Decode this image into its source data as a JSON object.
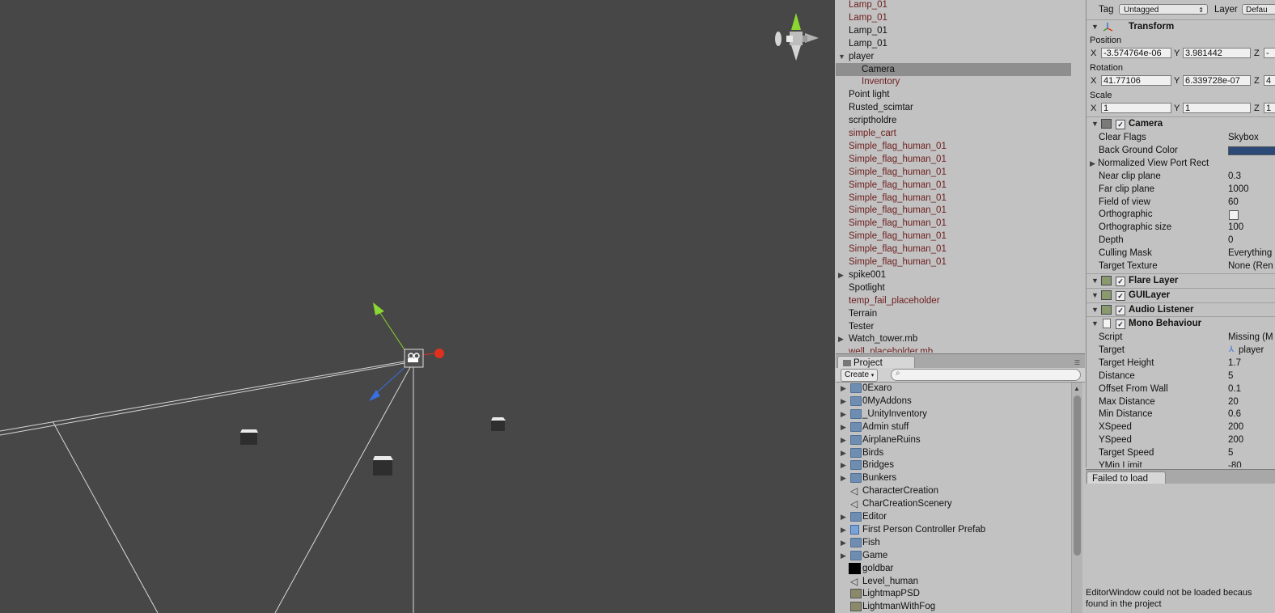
{
  "hierarchy": {
    "items": [
      {
        "label": "Lamp_01",
        "prefab": true
      },
      {
        "label": "Lamp_01",
        "prefab": true
      },
      {
        "label": "Lamp_01",
        "prefab": false
      },
      {
        "label": "Lamp_01",
        "prefab": false
      },
      {
        "label": "player",
        "prefab": false,
        "expanded": true
      },
      {
        "label": "Camera",
        "prefab": false,
        "selected": true,
        "child": true
      },
      {
        "label": "Inventory",
        "prefab": true,
        "child": true
      },
      {
        "label": "Point light",
        "prefab": false
      },
      {
        "label": "Rusted_scimtar",
        "prefab": false
      },
      {
        "label": "scriptholdre",
        "prefab": false
      },
      {
        "label": "simple_cart",
        "prefab": true
      },
      {
        "label": "Simple_flag_human_01",
        "prefab": true
      },
      {
        "label": "Simple_flag_human_01",
        "prefab": true
      },
      {
        "label": "Simple_flag_human_01",
        "prefab": true
      },
      {
        "label": "Simple_flag_human_01",
        "prefab": true
      },
      {
        "label": "Simple_flag_human_01",
        "prefab": true
      },
      {
        "label": "Simple_flag_human_01",
        "prefab": true
      },
      {
        "label": "Simple_flag_human_01",
        "prefab": true
      },
      {
        "label": "Simple_flag_human_01",
        "prefab": true
      },
      {
        "label": "Simple_flag_human_01",
        "prefab": true
      },
      {
        "label": "Simple_flag_human_01",
        "prefab": true
      },
      {
        "label": "spike001",
        "prefab": false,
        "collapsed": true
      },
      {
        "label": "Spotlight",
        "prefab": false
      },
      {
        "label": "temp_fail_placeholder",
        "prefab": true
      },
      {
        "label": "Terrain",
        "prefab": false
      },
      {
        "label": "Tester",
        "prefab": false
      },
      {
        "label": "Watch_tower.mb",
        "prefab": false,
        "collapsed": true
      },
      {
        "label": "well_placeholder.mb",
        "prefab": true
      }
    ]
  },
  "project": {
    "tab_label": "Project",
    "create_label": "Create",
    "items": [
      {
        "label": "0Exaro",
        "icon": "folder-icon",
        "expandable": true
      },
      {
        "label": "0MyAddons",
        "icon": "folder-icon",
        "expandable": true
      },
      {
        "label": "_UnityInventory",
        "icon": "folder-icon",
        "expandable": true
      },
      {
        "label": "Admin stuff",
        "icon": "folder-icon",
        "expandable": true
      },
      {
        "label": "AirplaneRuins",
        "icon": "folder-icon",
        "expandable": true
      },
      {
        "label": "Birds",
        "icon": "folder-icon",
        "expandable": true
      },
      {
        "label": "Bridges",
        "icon": "folder-icon",
        "expandable": true
      },
      {
        "label": "Bunkers",
        "icon": "folder-icon",
        "expandable": true
      },
      {
        "label": "CharacterCreation",
        "icon": "unity-scene-icon",
        "expandable": false
      },
      {
        "label": "CharCreationScenery",
        "icon": "unity-scene-icon",
        "expandable": false
      },
      {
        "label": "Editor",
        "icon": "folder-icon",
        "expandable": true
      },
      {
        "label": "First Person Controller Prefab",
        "icon": "prefab-icon",
        "expandable": true
      },
      {
        "label": "Fish",
        "icon": "folder-icon",
        "expandable": true
      },
      {
        "label": "Game",
        "icon": "folder-icon",
        "expandable": true
      },
      {
        "label": "goldbar",
        "icon": "black-square-icon",
        "expandable": false
      },
      {
        "label": "Level_human",
        "icon": "unity-scene-icon",
        "expandable": false
      },
      {
        "label": "LightmapPSD",
        "icon": "texture-icon",
        "expandable": false
      },
      {
        "label": "LightmanWithFog",
        "icon": "texture-icon",
        "expandable": false
      }
    ]
  },
  "inspector": {
    "tag_label": "Tag",
    "tag_value": "Untagged",
    "layer_label": "Layer",
    "layer_value": "Defau",
    "transform": {
      "title": "Transform",
      "position_label": "Position",
      "position": {
        "x": "-3.574764e-06",
        "y": "3.981442",
        "z": "-"
      },
      "rotation_label": "Rotation",
      "rotation": {
        "x": "41.77106",
        "y": "6.339728e-07",
        "z": "4"
      },
      "scale_label": "Scale",
      "scale": {
        "x": "1",
        "y": "1",
        "z": "1"
      }
    },
    "camera": {
      "title": "Camera",
      "props": [
        {
          "label": "Clear Flags",
          "value": "Skybox"
        },
        {
          "label": "Back Ground Color",
          "value": "",
          "color": "#2c4a78"
        },
        {
          "label": "Normalized View Port Rect",
          "value": "",
          "foldout": true
        },
        {
          "label": "Near clip plane",
          "value": "0.3"
        },
        {
          "label": "Far clip plane",
          "value": "1000"
        },
        {
          "label": "Field of view",
          "value": "60"
        },
        {
          "label": "Orthographic",
          "value": "",
          "checkbox": true
        },
        {
          "label": "Orthographic size",
          "value": "100"
        },
        {
          "label": "Depth",
          "value": "0"
        },
        {
          "label": "Culling Mask",
          "value": "Everything"
        },
        {
          "label": "Target Texture",
          "value": "None (Ren"
        }
      ]
    },
    "components": [
      {
        "title": "Flare Layer",
        "icon": "flare-layer-icon"
      },
      {
        "title": "GUILayer",
        "icon": "gui-layer-icon"
      },
      {
        "title": "Audio Listener",
        "icon": "audio-listener-icon"
      }
    ],
    "mono": {
      "title": "Mono Behaviour",
      "props": [
        {
          "label": "Script",
          "value": "Missing (M"
        },
        {
          "label": "Target",
          "value": "player"
        },
        {
          "label": "Target Height",
          "value": "1.7"
        },
        {
          "label": "Distance",
          "value": "5"
        },
        {
          "label": "Offset From Wall",
          "value": "0.1"
        },
        {
          "label": "Max Distance",
          "value": "20"
        },
        {
          "label": "Min Distance",
          "value": "0.6"
        },
        {
          "label": "XSpeed",
          "value": "200"
        },
        {
          "label": "YSpeed",
          "value": "200"
        },
        {
          "label": "Target Speed",
          "value": "5"
        },
        {
          "label": "YMin Limit",
          "value": "-80"
        }
      ]
    }
  },
  "failed": {
    "tab_label": "Failed to load",
    "message_line1": "EditorWindow could not be loaded becaus",
    "message_line2": "found in the project"
  },
  "colors": {
    "scene_bg": "#474747",
    "panel_bg": "#c2c2c2",
    "prefab_text": "#6e1d1d",
    "selection": "#8e8e8e",
    "axis_x": "#e0301e",
    "axis_y": "#8bd630",
    "axis_z": "#3a6fe0"
  }
}
